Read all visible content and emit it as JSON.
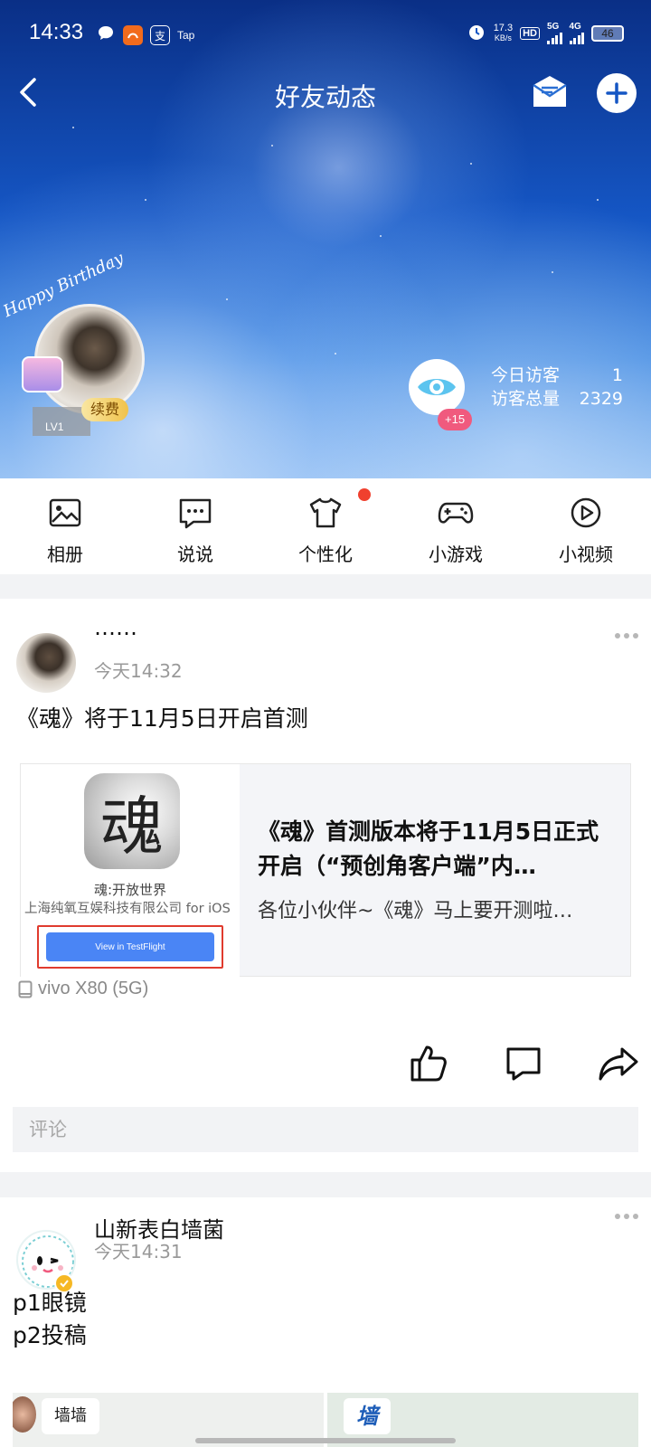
{
  "status_bar": {
    "time": "14:33",
    "left_icons": [
      "chat-bubble-icon",
      "app-icon-orange",
      "alipay-icon",
      "tap-icon"
    ],
    "alipay_glyph": "支",
    "tap_label": "Tap",
    "speed_value": "17.3",
    "speed_unit": "KB/s",
    "hd_label": "HD",
    "net_5g": "5G",
    "net_4g": "4G",
    "battery": "46"
  },
  "nav": {
    "title": "好友动态"
  },
  "profile": {
    "birthday_text": "Happy Birthday",
    "level": "LV1",
    "renew_label": "续费"
  },
  "visitors": {
    "badge": "+15",
    "today_label": "今日访客",
    "today_value": "1",
    "total_label": "访客总量",
    "total_value": "2329"
  },
  "shortcuts": [
    {
      "label": "相册",
      "icon": "album-icon"
    },
    {
      "label": "说说",
      "icon": "message-icon"
    },
    {
      "label": "个性化",
      "icon": "tshirt-icon"
    },
    {
      "label": "小游戏",
      "icon": "gamepad-icon"
    },
    {
      "label": "小视频",
      "icon": "video-icon"
    }
  ],
  "posts": [
    {
      "author": "……",
      "time": "今天14:32",
      "text": "《魂》将于11月5日开启首测",
      "share": {
        "app_glyph": "魂",
        "app_name": "魂:开放世界",
        "app_developer": "上海纯氧互娱科技有限公司 for iOS",
        "testflight_button": "View in TestFlight",
        "title": "《魂》首测版本将于11月5日正式开启（“预创角客户端”内…",
        "description": "各位小伙伴~《魂》马上要开测啦…"
      },
      "device": "vivo X80 (5G)",
      "comment_placeholder": "评论"
    },
    {
      "author": "山新表白墙菌",
      "time": "今天14:31",
      "text_lines": [
        "p1眼镜",
        "p2投稿"
      ],
      "tiles": [
        {
          "label": "墙墙"
        },
        {
          "label": "墙"
        }
      ]
    }
  ],
  "colors": {
    "accent_red": "#f0402e",
    "visitor_badge": "#f05a7e",
    "testflight_blue": "#4a85f5",
    "verified": "#f6b824"
  }
}
